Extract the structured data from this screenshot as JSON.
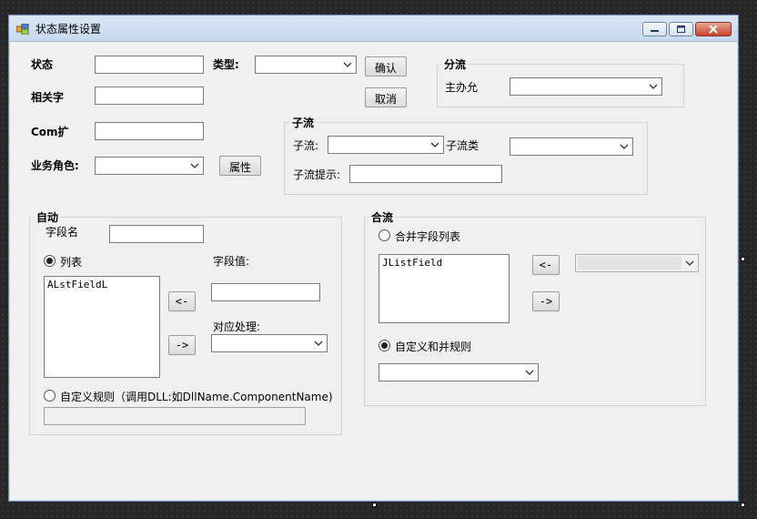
{
  "window": {
    "title": "状态属性设置"
  },
  "fields": {
    "state_label": "状态",
    "type_label": "类型:",
    "related_label": "相关字",
    "com_label": "Com扩",
    "role_label": "业务角色:",
    "property_button": "属性",
    "confirm_button": "确认",
    "cancel_button": "取消"
  },
  "split": {
    "title": "分流",
    "host_label": "主办允"
  },
  "subflow": {
    "title": "子流",
    "subflow_label": "子流:",
    "subflow_class_label": "子流类",
    "hint_label": "子流提示:"
  },
  "auto": {
    "title": "自动",
    "field_name_label": "字段名",
    "list_radio": "列表",
    "list_items": [
      "ALstFieldL"
    ],
    "field_value_label": "字段值:",
    "left_button": "<-",
    "right_button": "->",
    "handle_label": "对应处理:",
    "custom_rule_radio": "自定义规则（调用DLL:如DllName.ComponentName)"
  },
  "merge": {
    "title": "合流",
    "merge_fields_radio": "合并字段列表",
    "list_items": [
      "JListField"
    ],
    "left_button": "<-",
    "right_button": "->",
    "custom_merge_radio": "自定义和并规则"
  }
}
